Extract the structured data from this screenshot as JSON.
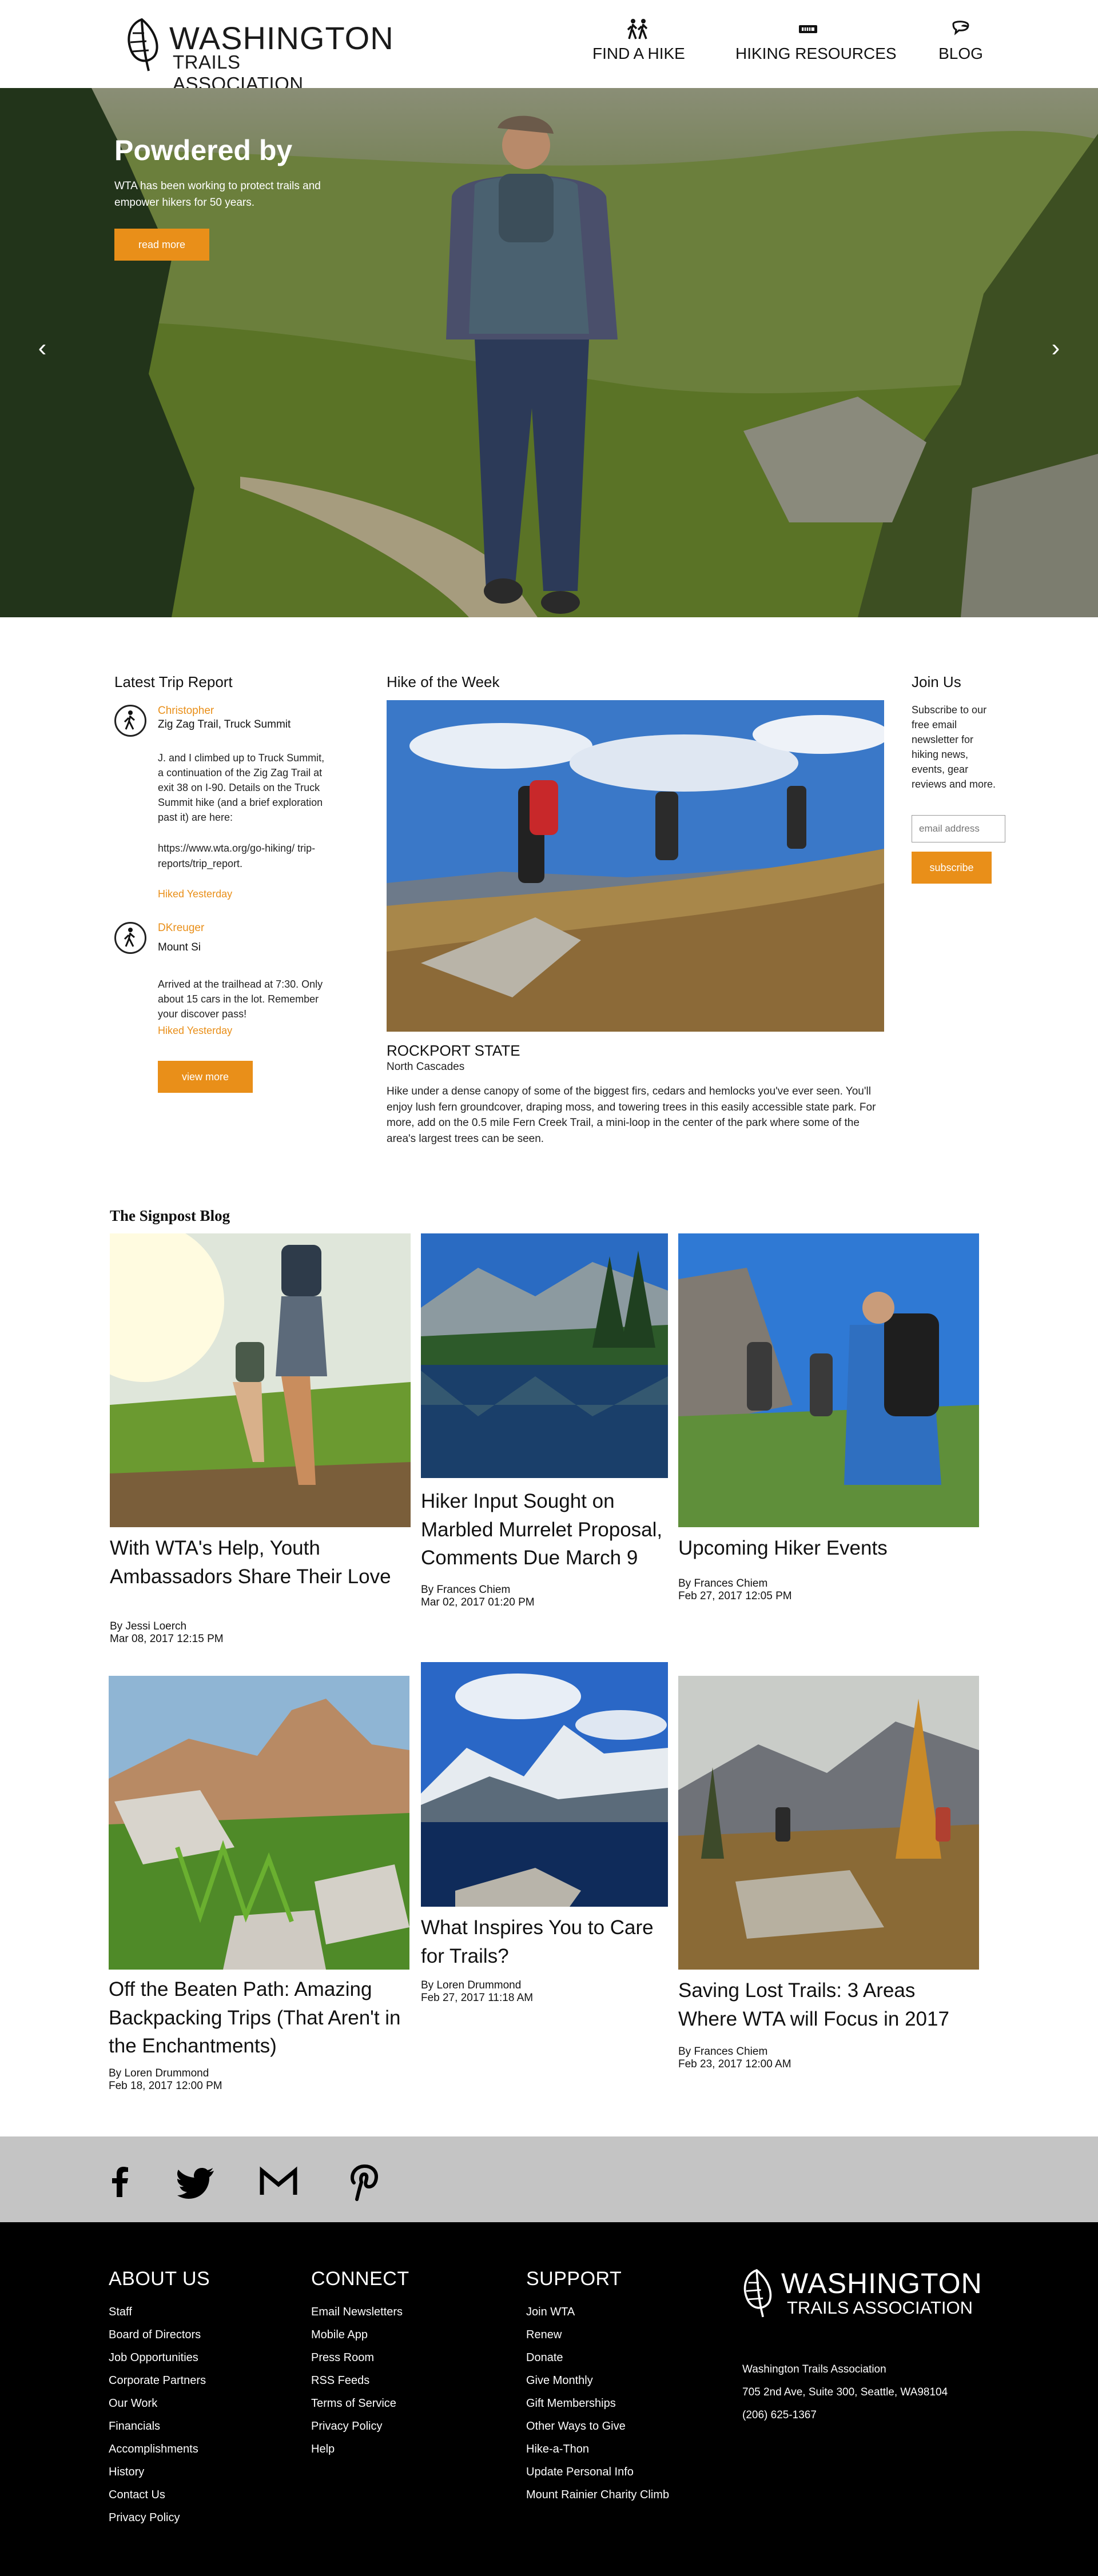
{
  "brand": {
    "name_line1": "WASHINGTON",
    "name_line2": "TRAILS ASSOCIATION"
  },
  "nav": [
    {
      "label": "FIND A HIKE",
      "icon": "hikers-icon"
    },
    {
      "label": "HIKING RESOURCES",
      "icon": "ticket-icon"
    },
    {
      "label": "BLOG",
      "icon": "chat-icon"
    }
  ],
  "hero": {
    "title": "Powdered by",
    "description": "WTA has been working to protect trails and empower hikers for 50 years.",
    "button": "read more"
  },
  "trip_reports": {
    "heading": "Latest Trip Report",
    "entries": [
      {
        "user": "Christopher",
        "location": "Zig Zag Trail, Truck Summit",
        "body": "J. and I climbed up to Truck Summit, a continuation of the Zig Zag Trail at exit 38 on I-90. Details on the Truck Summit hike (and a brief exploration past it) are here:",
        "link": "https://www.wta.org/go-hiking/ trip-reports/trip_report.",
        "when": "Hiked Yesterday"
      },
      {
        "user": "DKreuger",
        "location": "Mount Si",
        "body": "Arrived at the trailhead at 7:30. Only about 15 cars in the lot. Remember your discover pass!",
        "when": "Hiked Yesterday"
      }
    ],
    "button": "view more"
  },
  "hike_of_week": {
    "heading": "Hike of the Week",
    "name": "ROCKPORT STATE",
    "region": "North Cascades",
    "description": "Hike under a dense canopy of some of the biggest firs, cedars and hemlocks you've ever seen. You'll enjoy lush fern groundcover, draping moss, and towering trees in this easily accessible state park. For more, add on the 0.5 mile Fern Creek Trail, a mini-loop in the center of the park where some of the area's largest trees can be seen."
  },
  "join": {
    "heading": "Join Us",
    "text": "Subscribe to our free email newsletter for hiking news, events, gear reviews and more.",
    "placeholder": "email address",
    "button": "subscribe"
  },
  "blog": {
    "heading": "The Signpost Blog",
    "posts": [
      {
        "title": "With WTA's Help, Youth Ambassadors Share Their Love",
        "author": "By Jessi Loerch",
        "date": "Mar 08, 2017 12:15 PM"
      },
      {
        "title": "Hiker Input Sought on Marbled Murrelet Proposal, Comments Due March 9",
        "author": "By Frances Chiem",
        "date": "Mar 02, 2017 01:20 PM"
      },
      {
        "title": "Upcoming Hiker Events",
        "author": "By Frances Chiem",
        "date": "Feb 27, 2017 12:05 PM"
      },
      {
        "title": "Off the Beaten Path: Amazing Backpacking Trips (That Aren't in the Enchantments)",
        "author": "By Loren Drummond",
        "date": "Feb 18, 2017 12:00 PM"
      },
      {
        "title": "What Inspires You to Care for Trails?",
        "author": "By Loren Drummond",
        "date": "Feb 27, 2017 11:18 AM"
      },
      {
        "title": "Saving Lost Trails: 3 Areas Where WTA will Focus in 2017",
        "author": "By Frances Chiem",
        "date": "Feb 23, 2017 12:00 AM"
      }
    ]
  },
  "social": [
    "facebook-icon",
    "twitter-icon",
    "gmail-icon",
    "pinterest-icon"
  ],
  "footer": {
    "about": {
      "heading": "ABOUT US",
      "items": [
        "Staff",
        "Board of Directors",
        "Job Opportunities",
        "Corporate Partners",
        "Our Work",
        "Financials",
        "Accomplishments",
        "History",
        "Contact Us",
        "Privacy Policy"
      ]
    },
    "connect": {
      "heading": "CONNECT",
      "items": [
        "Email Newsletters",
        "Mobile App",
        "Press Room",
        "RSS Feeds",
        "Terms of Service",
        "Privacy Policy",
        "Help"
      ]
    },
    "support": {
      "heading": "SUPPORT",
      "items": [
        "Join WTA",
        "Renew",
        "Donate",
        "Give Monthly",
        "Gift Memberships",
        "Other Ways to Give",
        "Hike-a-Thon",
        "Update Personal Info",
        "Mount Rainier Charity Climb"
      ]
    },
    "org": "Washington Trails Association",
    "address": "705 2nd Ave, Suite 300, Seattle, WA98104",
    "phone": "(206) 625-1367"
  },
  "colors": {
    "accent": "#e98f19",
    "social_band": "#c4c4c4",
    "footer_bg": "#000000"
  }
}
